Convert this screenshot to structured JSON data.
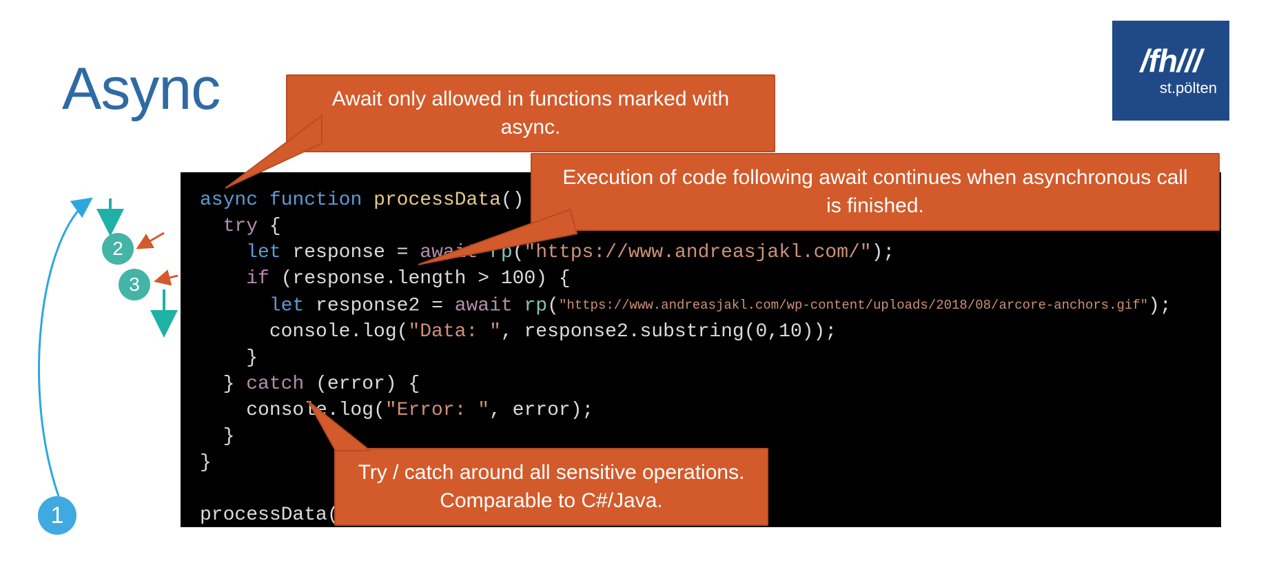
{
  "title": "Async",
  "logo": {
    "big": "/fh///",
    "small": "st.pölten"
  },
  "callouts": {
    "c1": "Await only allowed in functions marked with async.",
    "c2": "Execution of code following await continues when asynchronous call is finished.",
    "c3": "Try / catch around all sensitive operations. Comparable to C#/Java."
  },
  "markers": {
    "m1": "1",
    "m2": "2",
    "m3": "3"
  },
  "code": {
    "l1_async": "async",
    "l1_function": "function",
    "l1_name": "processData",
    "l1_rest": "() {",
    "l2_try": "try",
    "l2_rest": " {",
    "l3_let": "let",
    "l3_var": " response = ",
    "l3_await": "await",
    "l3_fn": " rp",
    "l3_paren": "(",
    "l3_url": "\"https://www.andreasjakl.com/\"",
    "l3_close": ");",
    "l4_if": "if",
    "l4_rest": " (response.length > 100) {",
    "l5_let": "let",
    "l5_var": " response2 = ",
    "l5_await": "await",
    "l5_fn": " rp",
    "l5_paren": "(",
    "l5_url": "\"https://www.andreasjakl.com/wp-content/uploads/2018/08/arcore-anchors.gif\"",
    "l5_close": ");",
    "l6_a": "      console.log(",
    "l6_str": "\"Data: \"",
    "l6_b": ", response2.substring(0,10));",
    "l7": "    }",
    "l8a": "  } ",
    "l8_catch": "catch",
    "l8b": " (error) {",
    "l9_a": "    console.log(",
    "l9_str": "\"Error: \"",
    "l9_b": ", error);",
    "l10": "  }",
    "l11": "}",
    "l12": "processData();"
  }
}
